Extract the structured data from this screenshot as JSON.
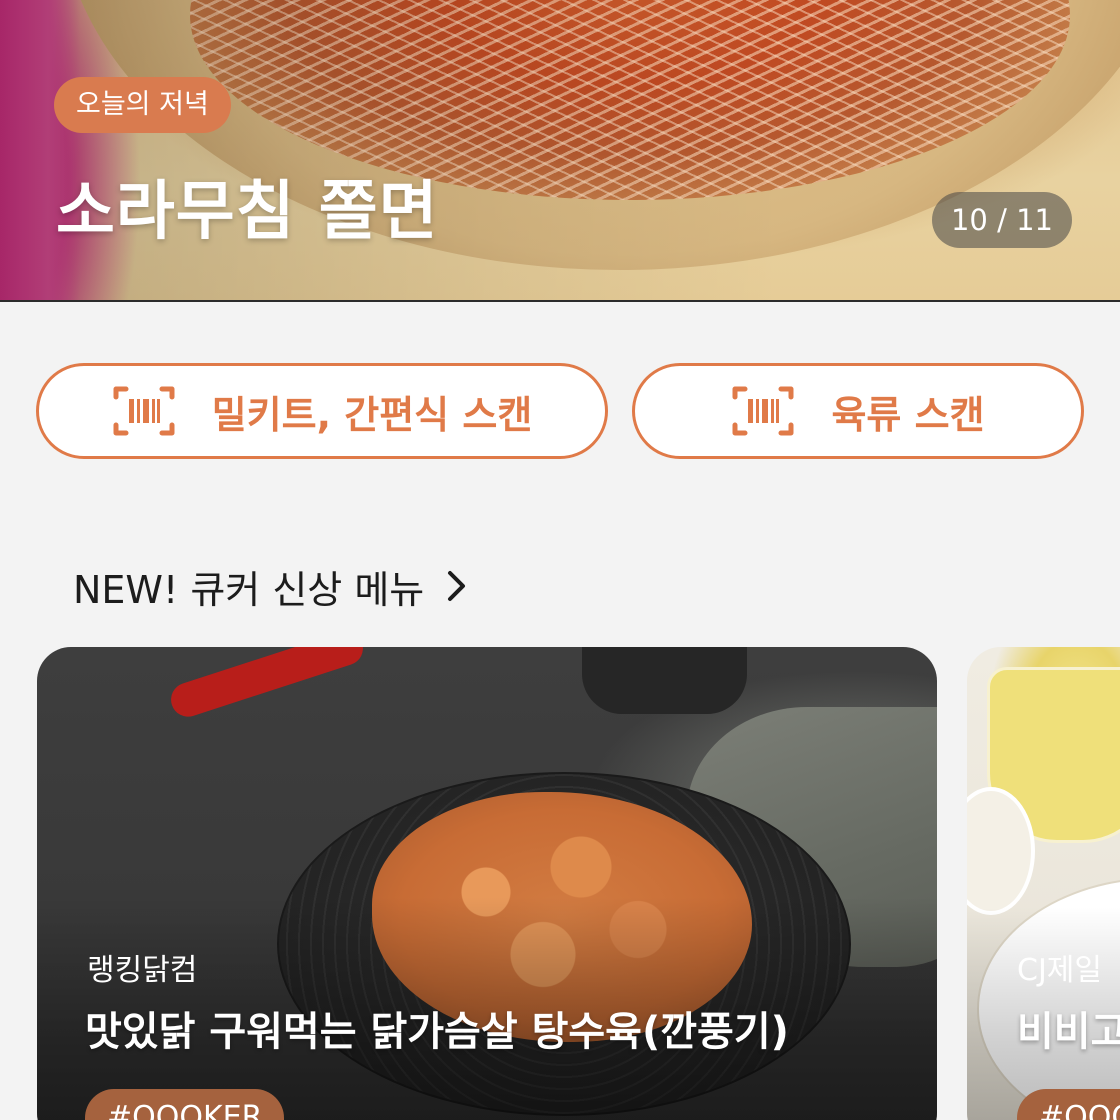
{
  "hero": {
    "tag": "오늘의 저녁",
    "title": "소라무침 쫄면",
    "counter": "10 / 11"
  },
  "scan_buttons": {
    "mealkit": {
      "label": "밀키트, 간편식 스캔",
      "icon": "barcode-scan-icon"
    },
    "meat": {
      "label": "육류 스캔",
      "icon": "barcode-scan-icon"
    }
  },
  "section": {
    "title": "NEW! 큐커 신상 메뉴",
    "icon": "chevron-right-icon"
  },
  "cards": [
    {
      "brand": "랭킹닭컴",
      "name": "맛있닭 구워먹는 닭가슴살 탕수육(깐풍기)",
      "tag": "#QOOKER"
    },
    {
      "brand": "CJ제일",
      "name": "비비고",
      "tag": "#QOO"
    }
  ],
  "colors": {
    "accent": "#e07a48",
    "tag_bg": "#d97b4f",
    "card_tag_bg": "#a5623e",
    "background": "#f3f3f3"
  }
}
